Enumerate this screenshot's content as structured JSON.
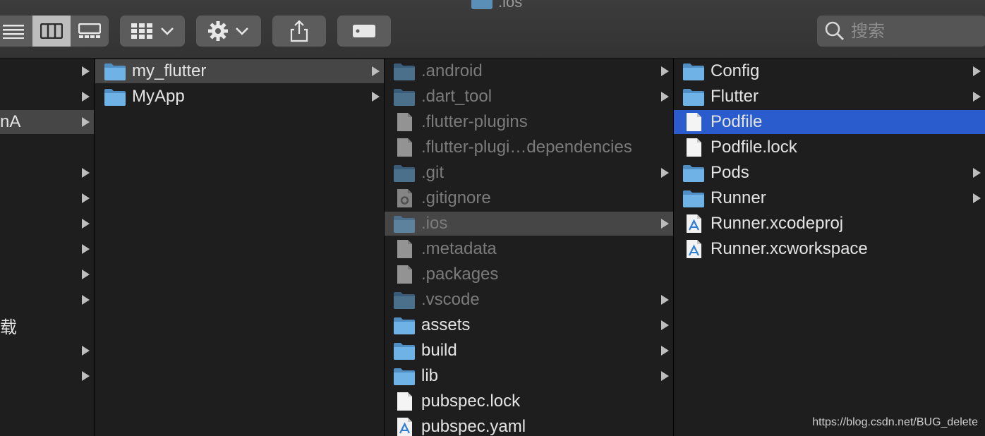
{
  "window": {
    "title": ".ios"
  },
  "toolbar": {
    "view_modes": [
      "list-view-icon",
      "column-view-icon",
      "gallery-view-icon"
    ],
    "search_placeholder": "搜索"
  },
  "columns": {
    "col1": {
      "items": [
        {
          "label": "",
          "arrow": true
        },
        {
          "label": "",
          "arrow": true
        },
        {
          "label": "nA",
          "arrow": true,
          "selected": "gray"
        },
        {
          "label": "",
          "arrow": false
        },
        {
          "label": "",
          "arrow": true
        },
        {
          "label": "",
          "arrow": true
        },
        {
          "label": "",
          "arrow": true
        },
        {
          "label": "",
          "arrow": true
        },
        {
          "label": "",
          "arrow": true
        },
        {
          "label": "",
          "arrow": true
        },
        {
          "label": "载",
          "arrow": false
        },
        {
          "label": "",
          "arrow": true
        },
        {
          "label": "",
          "arrow": true
        }
      ]
    },
    "col2": {
      "items": [
        {
          "label": "my_flutter",
          "type": "folder",
          "arrow": true,
          "selected": "gray"
        },
        {
          "label": "MyApp",
          "type": "folder",
          "arrow": true
        }
      ]
    },
    "col3": {
      "items": [
        {
          "label": ".android",
          "type": "folder",
          "arrow": true,
          "hidden": true
        },
        {
          "label": ".dart_tool",
          "type": "folder",
          "arrow": true,
          "hidden": true
        },
        {
          "label": ".flutter-plugins",
          "type": "file",
          "arrow": false,
          "hidden": true
        },
        {
          "label": ".flutter-plugi…dependencies",
          "type": "file",
          "arrow": false,
          "hidden": true
        },
        {
          "label": ".git",
          "type": "folder",
          "arrow": true,
          "hidden": true
        },
        {
          "label": ".gitignore",
          "type": "gearfile",
          "arrow": false,
          "hidden": true
        },
        {
          "label": ".ios",
          "type": "folder",
          "arrow": true,
          "hidden": true,
          "selected": "gray"
        },
        {
          "label": ".metadata",
          "type": "file",
          "arrow": false,
          "hidden": true
        },
        {
          "label": ".packages",
          "type": "file",
          "arrow": false,
          "hidden": true
        },
        {
          "label": ".vscode",
          "type": "folder",
          "arrow": true,
          "hidden": true
        },
        {
          "label": "assets",
          "type": "folder",
          "arrow": true
        },
        {
          "label": "build",
          "type": "folder",
          "arrow": true
        },
        {
          "label": "lib",
          "type": "folder",
          "arrow": true
        },
        {
          "label": "pubspec.lock",
          "type": "file",
          "arrow": false
        },
        {
          "label": "pubspec.yaml",
          "type": "yaml",
          "arrow": false
        }
      ]
    },
    "col4": {
      "items": [
        {
          "label": "Config",
          "type": "folder",
          "arrow": true
        },
        {
          "label": "Flutter",
          "type": "folder",
          "arrow": true
        },
        {
          "label": "Podfile",
          "type": "file",
          "arrow": false,
          "selected": "blue"
        },
        {
          "label": "Podfile.lock",
          "type": "file",
          "arrow": false
        },
        {
          "label": "Pods",
          "type": "folder",
          "arrow": true
        },
        {
          "label": "Runner",
          "type": "folder",
          "arrow": true
        },
        {
          "label": "Runner.xcodeproj",
          "type": "xcode",
          "arrow": false
        },
        {
          "label": "Runner.xcworkspace",
          "type": "xcode",
          "arrow": false
        }
      ]
    }
  },
  "watermark": "https://blog.csdn.net/BUG_delete",
  "colors": {
    "selection_blue": "#2a5cce",
    "folder_blue": "#6fb3e6"
  }
}
